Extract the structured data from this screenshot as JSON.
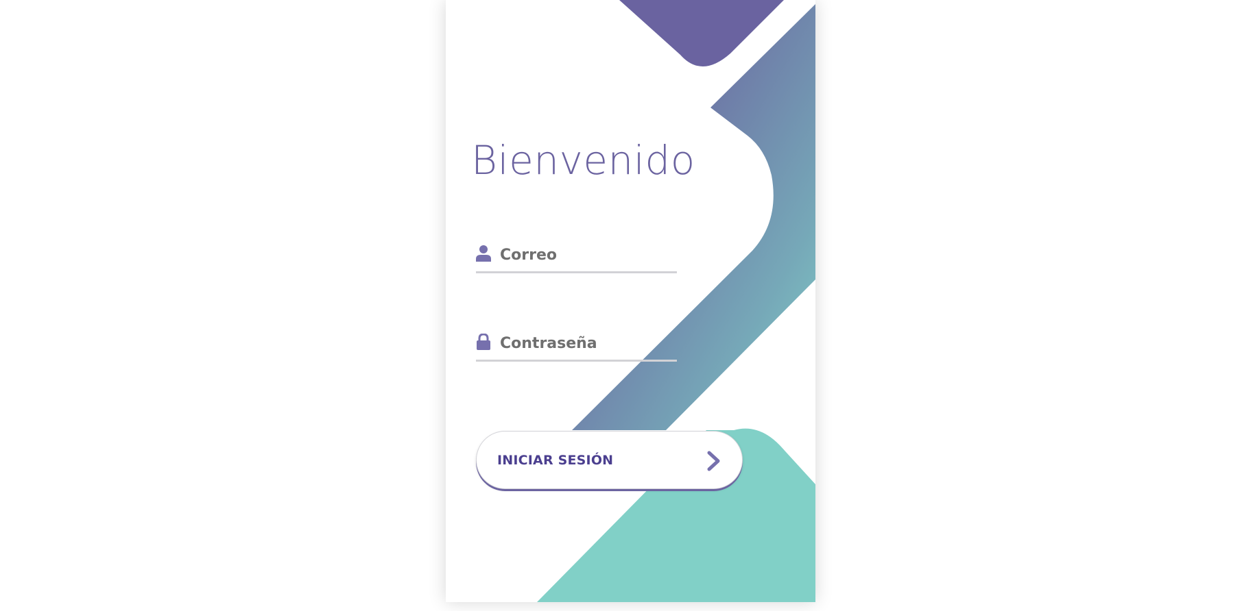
{
  "login": {
    "title": "Bienvenido",
    "email_placeholder": "Correo",
    "password_placeholder": "Contraseña",
    "submit_label": "INICIAR SESIÓN"
  },
  "icons": {
    "email": "user-icon",
    "password": "lock-icon",
    "submit": "chevron-right-icon"
  },
  "colors": {
    "purple": "#6b63a0",
    "teal": "#81d0c7",
    "button_text": "#4b3f8f",
    "placeholder": "#6f6f6f",
    "underline": "#d2d2d6"
  }
}
